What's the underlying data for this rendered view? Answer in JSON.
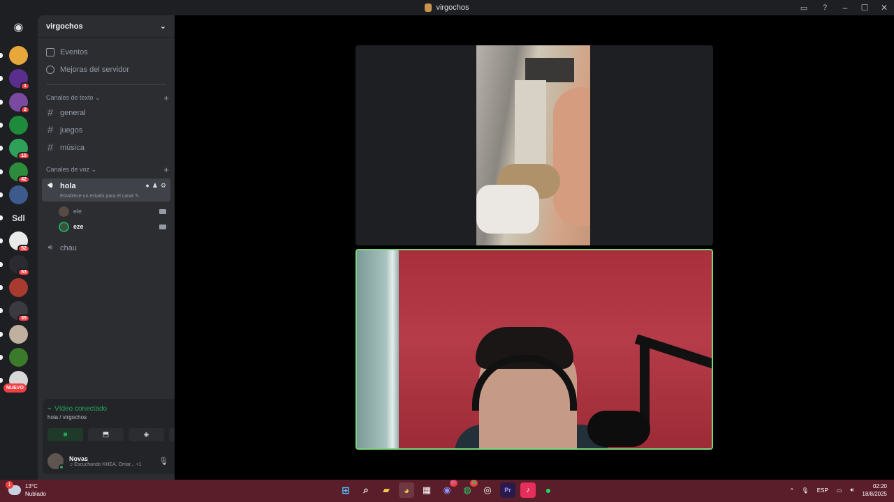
{
  "window": {
    "title": "virgochos"
  },
  "guilds": {
    "items": [
      {
        "name": "guild-1",
        "color": "#e7a73a"
      },
      {
        "name": "guild-2",
        "color": "#5a2e8c",
        "badge": "1"
      },
      {
        "name": "guild-3",
        "color": "#7a4aa0",
        "badge": "2"
      },
      {
        "name": "guild-4",
        "color": "#1e8a3c"
      },
      {
        "name": "guild-5",
        "color": "#2fa05a",
        "badge": "15"
      },
      {
        "name": "guild-6",
        "color": "#2c8c3c",
        "badge": "42"
      },
      {
        "name": "guild-7",
        "color": "#3c5a8c"
      },
      {
        "name": "guild-8",
        "text": "Sdl"
      },
      {
        "name": "guild-9",
        "color": "#eaeaea",
        "badge": "52"
      },
      {
        "name": "guild-10",
        "color": "#2a2a30",
        "badge": "53"
      },
      {
        "name": "guild-11",
        "color": "#a83a30"
      },
      {
        "name": "guild-12",
        "color": "#3a3a40",
        "badge": "35"
      },
      {
        "name": "guild-13",
        "color": "#c0b0a0"
      },
      {
        "name": "guild-14",
        "color": "#3a7a2a"
      },
      {
        "name": "guild-15",
        "color": "#d8d8d8"
      }
    ],
    "new_label": "NUEVO"
  },
  "sidebar": {
    "server_name": "virgochos",
    "events": "Eventos",
    "boosts": "Mejoras del servidor",
    "text_category": "Canales de texto",
    "text_channels": [
      "general",
      "juegos",
      "música"
    ],
    "voice_category": "Canales de voz",
    "active_voice": {
      "name": "hola",
      "status": "Establece un estado para el canal"
    },
    "members": [
      {
        "name": "ele",
        "speaking": false
      },
      {
        "name": "eze",
        "speaking": true
      }
    ],
    "other_voice": "chau"
  },
  "rtc": {
    "status": "Vídeo conectado",
    "location": "hola / virgochos"
  },
  "user": {
    "name": "Novas",
    "activity": "Escuchando KHEA, Omar...",
    "extra": "+1"
  },
  "taskbar": {
    "temp": "13°C",
    "weather": "Nublado",
    "weather_badge": "1",
    "discord_badge": "9+",
    "whatsapp_badge": "15",
    "lang": "ESP",
    "time": "02:20",
    "date": "18/8/2025"
  }
}
